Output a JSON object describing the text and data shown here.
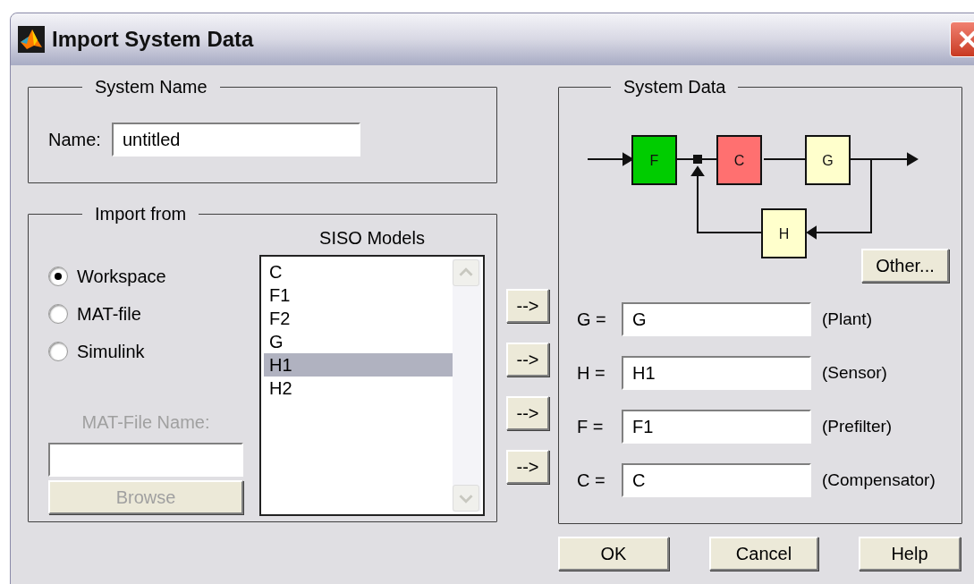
{
  "window": {
    "title": "Import System Data"
  },
  "system_name": {
    "legend": "System Name",
    "label": "Name:",
    "value": "untitled"
  },
  "import_from": {
    "legend": "Import from",
    "sources": [
      {
        "label": "Workspace",
        "selected": true
      },
      {
        "label": "MAT-file",
        "selected": false
      },
      {
        "label": "Simulink",
        "selected": false
      }
    ],
    "mat_file": {
      "label": "MAT-File Name:",
      "browse": "Browse",
      "disabled": true
    },
    "models": {
      "title": "SISO Models",
      "items": [
        {
          "label": "C",
          "selected": false
        },
        {
          "label": "F1",
          "selected": false
        },
        {
          "label": "F2",
          "selected": false
        },
        {
          "label": "G",
          "selected": false
        },
        {
          "label": "H1",
          "selected": true
        },
        {
          "label": "H2",
          "selected": false
        }
      ]
    }
  },
  "transfer_buttons": [
    "-->",
    "-->",
    "-->",
    "-->"
  ],
  "system_data": {
    "legend": "System Data",
    "blocks": [
      {
        "label": "F",
        "color": "#00cc00"
      },
      {
        "label": "C",
        "color": "#ff7070"
      },
      {
        "label": "G",
        "color": "#ffffcc"
      },
      {
        "label": "H",
        "color": "#ffffcc"
      }
    ],
    "other": "Other...",
    "fields": [
      {
        "label": "G =",
        "value": "G",
        "role": "(Plant)"
      },
      {
        "label": "H =",
        "value": "H1",
        "role": "(Sensor)"
      },
      {
        "label": "F =",
        "value": "F1",
        "role": "(Prefilter)"
      },
      {
        "label": "C =",
        "value": "C",
        "role": "(Compensator)"
      }
    ]
  },
  "buttons": [
    "OK",
    "Cancel",
    "Help"
  ]
}
